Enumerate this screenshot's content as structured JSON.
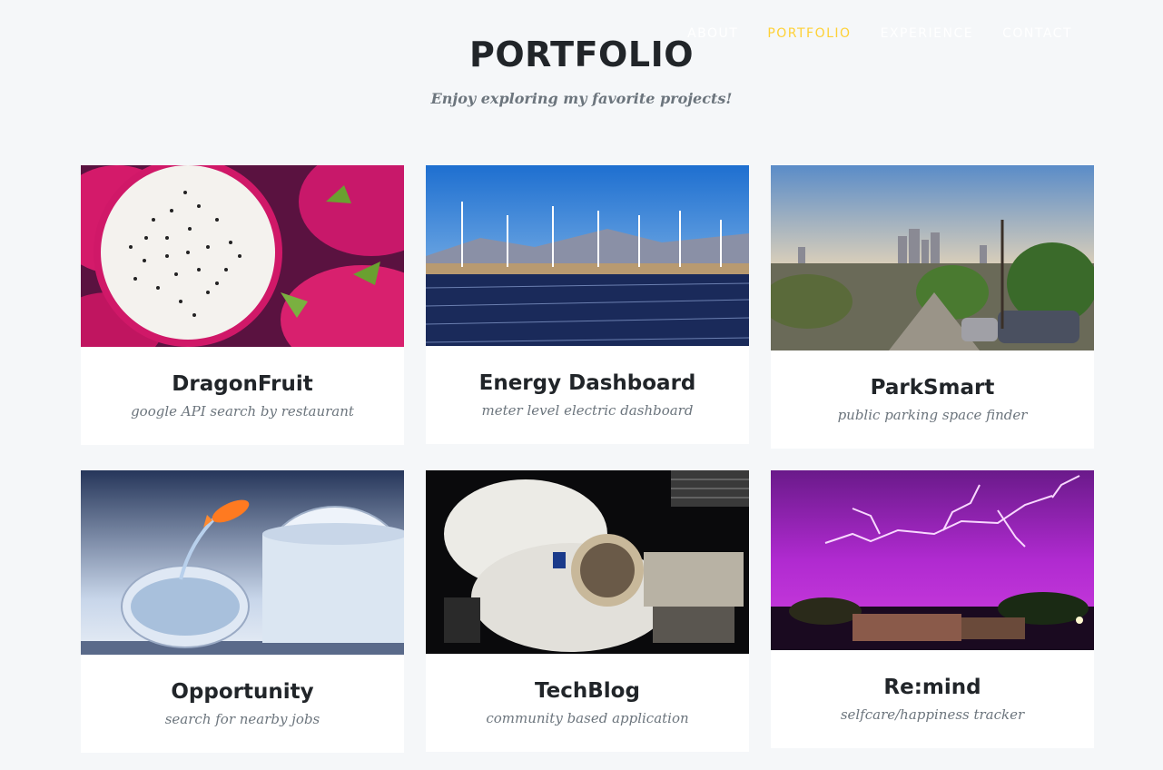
{
  "nav": {
    "items": [
      {
        "label": "About",
        "active": false
      },
      {
        "label": "Portfolio",
        "active": true
      },
      {
        "label": "Experience",
        "active": false
      },
      {
        "label": "Contact",
        "active": false
      }
    ],
    "active_color": "#fed136"
  },
  "section": {
    "title": "PORTFOLIO",
    "subtitle": "Enjoy exploring my favorite projects!"
  },
  "projects": [
    {
      "title": "DragonFruit",
      "subtitle": "google API search by restaurant",
      "image": "dragonfruit-photo"
    },
    {
      "title": "Energy Dashboard",
      "subtitle": "meter level electric dashboard",
      "image": "wind-solar-farm-photo"
    },
    {
      "title": "ParkSmart",
      "subtitle": "public parking space finder",
      "image": "city-street-photo"
    },
    {
      "title": "Opportunity",
      "subtitle": "search for nearby jobs",
      "image": "goldfish-jump-photo"
    },
    {
      "title": "TechBlog",
      "subtitle": "community based application",
      "image": "astronaut-photo"
    },
    {
      "title": "Re:mind",
      "subtitle": "selfcare/happiness tracker",
      "image": "lightning-storm-photo"
    }
  ]
}
